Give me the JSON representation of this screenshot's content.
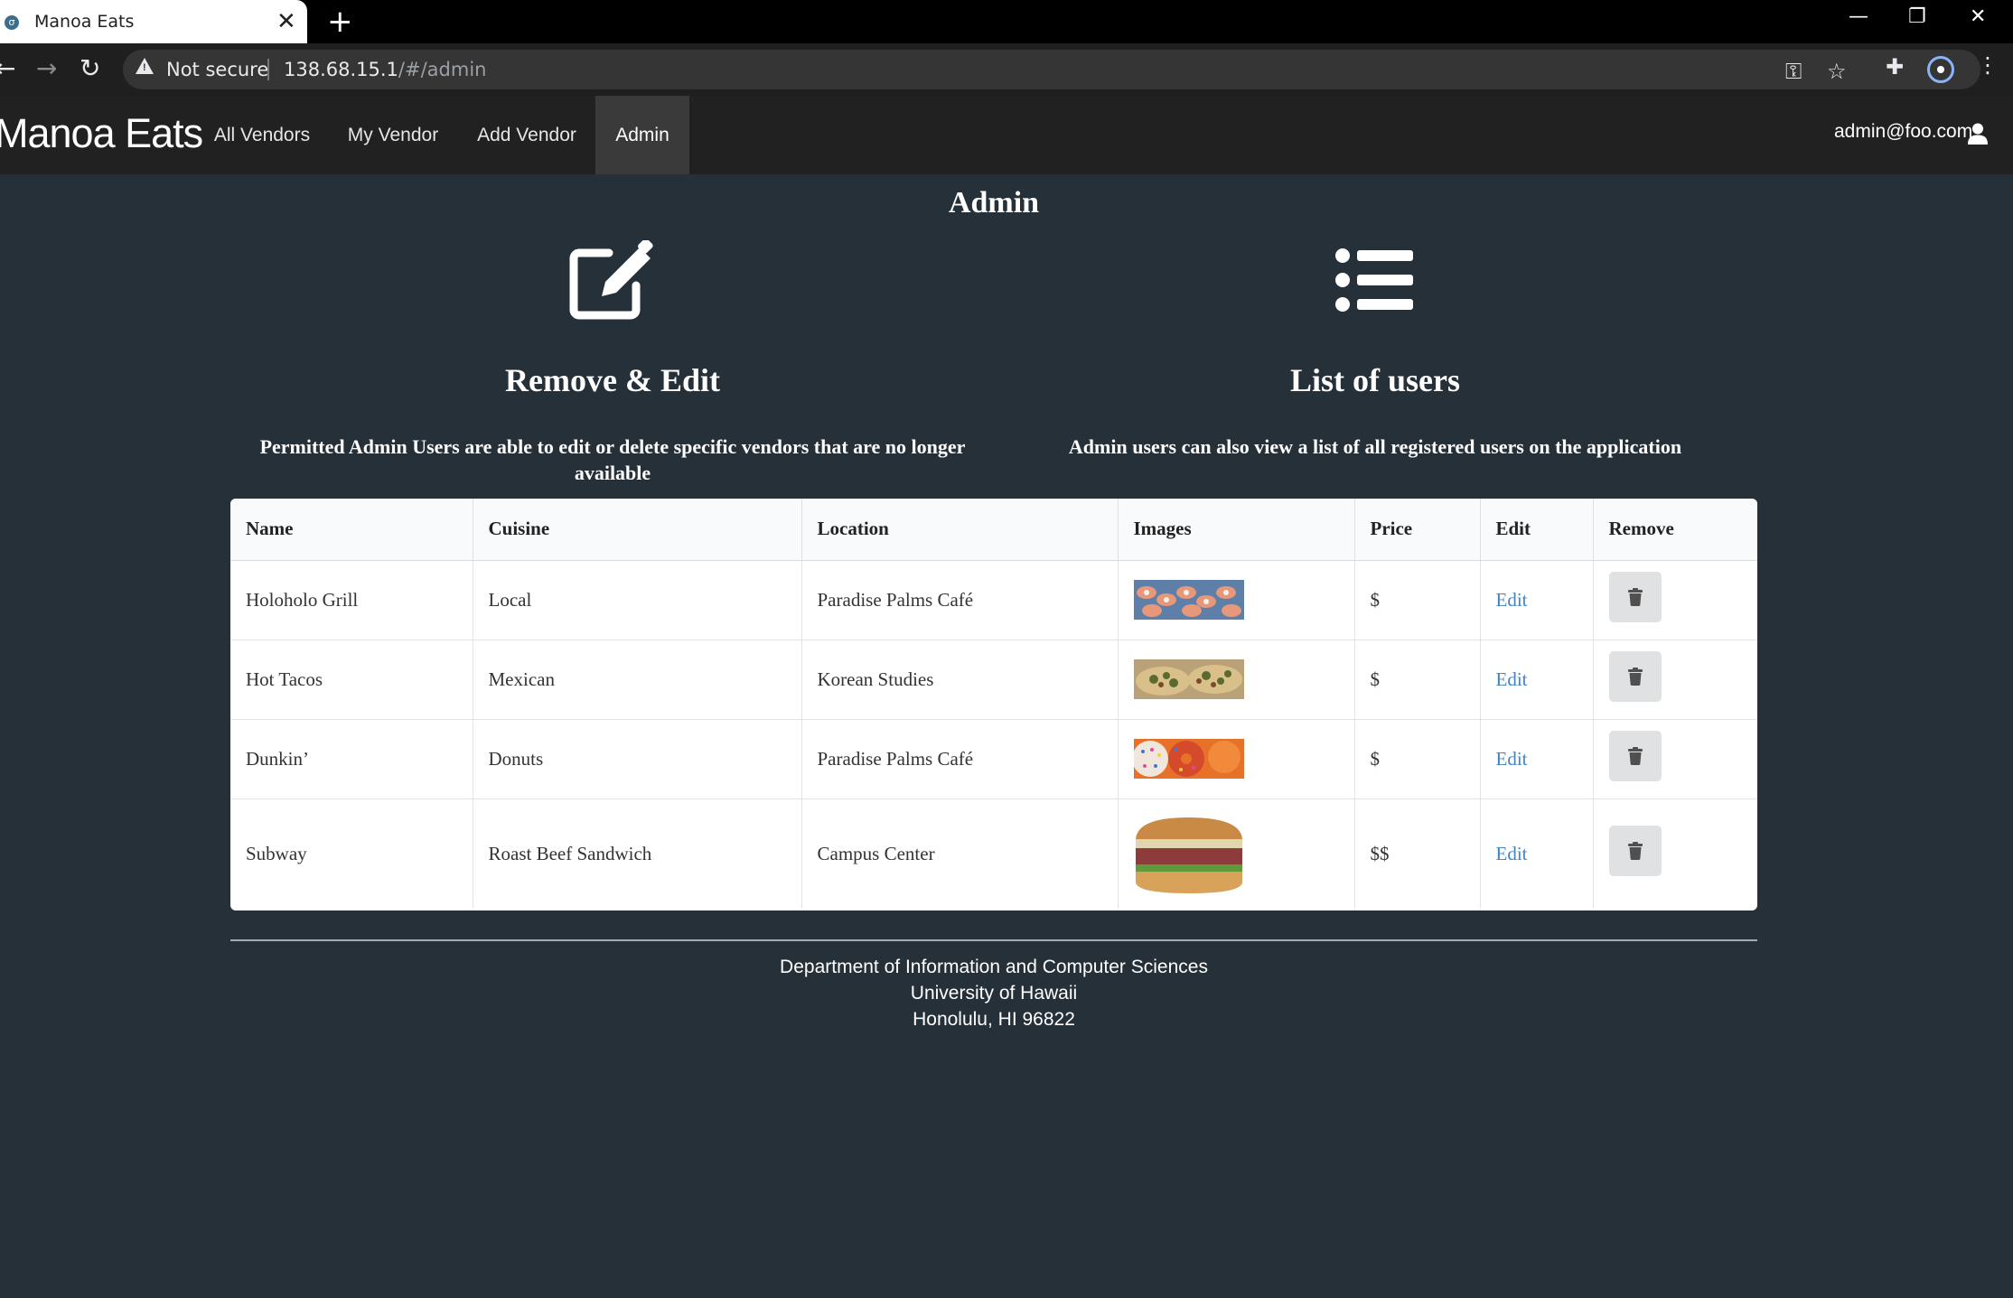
{
  "browser": {
    "tab_title": "Manoa Eats",
    "tab_close": "✕",
    "new_tab": "+",
    "security_label": "Not secure",
    "url_host": "138.68.15.1",
    "url_path": "/#/admin",
    "window_controls": [
      "—",
      "❐",
      "✕"
    ]
  },
  "navbar": {
    "brand": "Manoa Eats",
    "links": [
      {
        "label": "All Vendors",
        "active": false
      },
      {
        "label": "My Vendor",
        "active": false
      },
      {
        "label": "Add Vendor",
        "active": false
      },
      {
        "label": "Admin",
        "active": true
      }
    ],
    "user": "admin@foo.com",
    "user_icon": "user-icon"
  },
  "page": {
    "title": "Admin",
    "features": [
      {
        "icon": "edit-icon",
        "heading": "Remove & Edit",
        "text": "Permitted Admin Users are able to edit or delete specific vendors that are no longer available"
      },
      {
        "icon": "list-icon",
        "heading": "List of users",
        "text": "Admin users can also view a list of all registered users on the application"
      }
    ]
  },
  "table": {
    "headers": [
      "Name",
      "Cuisine",
      "Location",
      "Images",
      "Price",
      "Edit",
      "Remove"
    ],
    "rows": [
      {
        "name": "Holoholo Grill",
        "cuisine": "Local",
        "location": "Paradise Palms Café",
        "image": "sushi-thumbnail",
        "price": "$",
        "edit": "Edit"
      },
      {
        "name": "Hot Tacos",
        "cuisine": "Mexican",
        "location": "Korean Studies",
        "image": "tacos-thumbnail",
        "price": "$",
        "edit": "Edit"
      },
      {
        "name": "Dunkin’",
        "cuisine": "Donuts",
        "location": "Paradise Palms Café",
        "image": "donuts-thumbnail",
        "price": "$",
        "edit": "Edit"
      },
      {
        "name": "Subway",
        "cuisine": "Roast Beef Sandwich",
        "location": "Campus Center",
        "image": "sandwich-thumbnail",
        "price": "$$",
        "edit": "Edit"
      }
    ]
  },
  "footer": {
    "line1": "Department of Information and Computer Sciences",
    "line2": "University of Hawaii",
    "line3": "Honolulu, HI 96822"
  },
  "colors": {
    "page_bg": "#263038",
    "navbar_bg": "#212121",
    "link": "#4183c4"
  }
}
